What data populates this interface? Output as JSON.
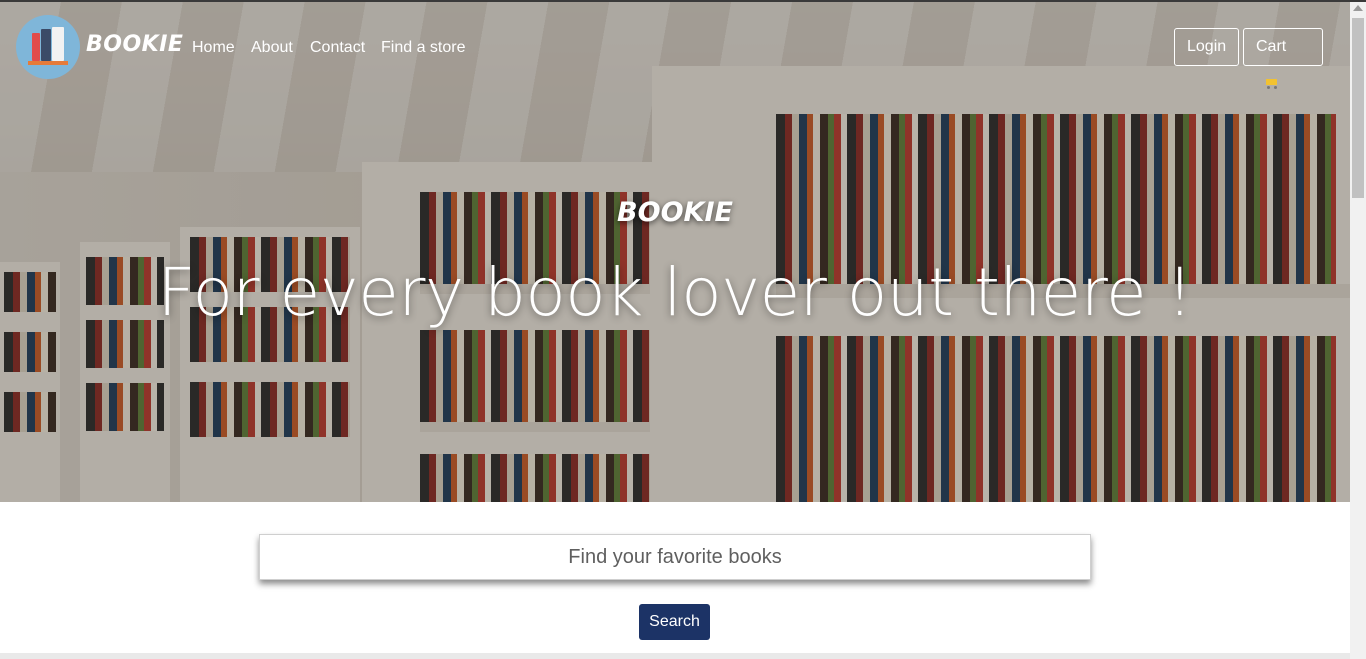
{
  "brand": {
    "name": "BOOKIE"
  },
  "nav": {
    "links": [
      "Home",
      "About",
      "Contact",
      "Find a store"
    ],
    "login_label": "Login",
    "cart_label": "Cart"
  },
  "hero": {
    "brand": "BOOKIE",
    "tagline": "For every book lover out there !"
  },
  "search": {
    "placeholder": "Find your favorite books",
    "button_label": "Search"
  },
  "colors": {
    "search_button": "#1c3366",
    "logo_circle": "#7fb6d9"
  },
  "icons": [
    "logo-books-icon",
    "cart-icon"
  ]
}
